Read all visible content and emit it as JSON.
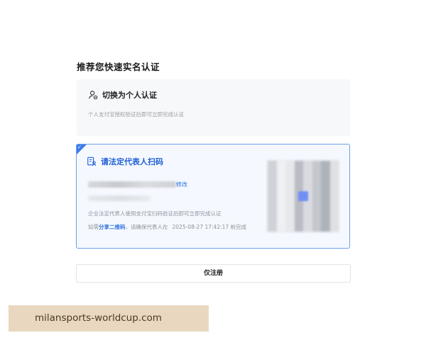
{
  "heading": "推荐您快速实名认证",
  "personal_option": {
    "title": "切换为个人认证",
    "subtitle": "个人支付宝授权验证后即可立即完成认证",
    "icon": "person-switch-icon"
  },
  "legal_option": {
    "title": "请法定代表人扫码",
    "icon": "document-person-icon",
    "edit_label": "修改",
    "description": "企业法定代表人使用支付宝扫码验证后即可立即完成认证",
    "share_prefix": "如需",
    "share_link": "分享二维码",
    "share_suffix": "，请确保代表人在",
    "deadline": "2025-08-27 17:42:17 前完成",
    "selected": true
  },
  "register_only_label": "仅注册",
  "watermark": "milansports-worldcup.com",
  "colors": {
    "accent": "#2f6fe0",
    "selected_border": "#6f9ee8",
    "selected_bg": "#f5f9ff"
  }
}
